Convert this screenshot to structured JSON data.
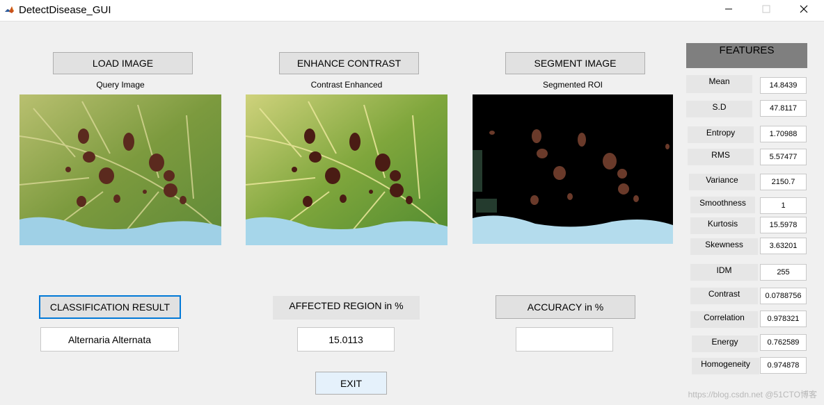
{
  "window": {
    "title": "DetectDisease_GUI",
    "icon": "matlab-icon",
    "controls": [
      "minimize-icon",
      "maximize-icon",
      "close-icon"
    ]
  },
  "buttons": {
    "load": "LOAD IMAGE",
    "enhance": "ENHANCE CONTRAST",
    "segment": "SEGMENT IMAGE",
    "classification": "CLASSIFICATION RESULT",
    "exit": "EXIT"
  },
  "panels": {
    "query_caption": "Query Image",
    "enhanced_caption": "Contrast Enhanced",
    "segmented_caption": "Segmented ROI"
  },
  "results": {
    "classification_value": "Alternaria Alternata",
    "affected_label": "AFFECTED REGION in %",
    "affected_value": "15.0113",
    "accuracy_label": "ACCURACY in %",
    "accuracy_value": ""
  },
  "features": {
    "header": "FEATURES",
    "items": [
      {
        "label": "Mean",
        "value": "14.8439"
      },
      {
        "label": "S.D",
        "value": "47.8117"
      },
      {
        "label": "Entropy",
        "value": "1.70988"
      },
      {
        "label": "RMS",
        "value": "5.57477"
      },
      {
        "label": "Variance",
        "value": "2150.7"
      },
      {
        "label": "Smoothness",
        "value": "1"
      },
      {
        "label": "Kurtosis",
        "value": "15.5978"
      },
      {
        "label": "Skewness",
        "value": "3.63201"
      },
      {
        "label": "IDM",
        "value": "255"
      },
      {
        "label": "Contrast",
        "value": "0.0788756"
      },
      {
        "label": "Correlation",
        "value": "0.978321"
      },
      {
        "label": "Energy",
        "value": "0.762589"
      },
      {
        "label": "Homogeneity",
        "value": "0.974878"
      }
    ]
  },
  "watermark": "https://blog.csdn.net @51CTO博客",
  "colors": {
    "focus": "#0078d7",
    "window_bg": "#f0f0f0"
  }
}
